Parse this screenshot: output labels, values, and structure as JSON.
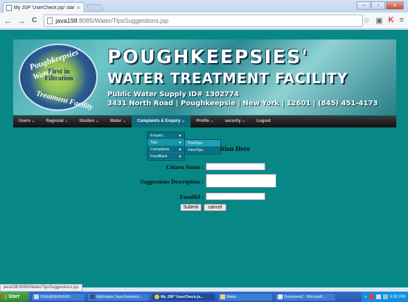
{
  "browser": {
    "tab_title": "My JSP 'UserCheck.jsp' starti",
    "tab_close": "×",
    "window_buttons": [
      "–",
      "▫",
      "x"
    ],
    "nav": {
      "back": "←",
      "forward": "→",
      "reload": "C"
    },
    "url_host": "java198",
    "url_path": ":8085/Water/TipsSuggestions.jsp",
    "status_text": "java198:8085/Water/TipsSuggestions.jsp"
  },
  "banner": {
    "logo_top": "Poughkeepsies' Water",
    "logo_center": "First in Filtration",
    "logo_bottom": "Treatment Facility",
    "title": "POUGHKEEPSIES'",
    "subtitle": "WATER TREATMENT FACILITY",
    "line1": "Public Water Supply ID# 1302774",
    "line2": "3431 North Road | Poughkeepsie | New York | 12601 | (845) 451-4173"
  },
  "menu": {
    "items": [
      "Users ⌄",
      "Regional ⌄",
      "Studies ⌄",
      "Water ⌄",
      "Complaints & Enquiry ⌄",
      "Profile ⌄",
      "security ⌄",
      "Logout"
    ]
  },
  "dropdown": {
    "items": [
      "Enquiry",
      "Tips",
      "Complaints",
      "FeedBack"
    ],
    "arrow": "►"
  },
  "submenu": {
    "items": [
      "PostTips",
      "ViewTips"
    ]
  },
  "form": {
    "heading": "ition Here",
    "citizen_label": "Citizen Name :",
    "suggestions_label": "Suggestions Description :",
    "email_label": "EmailId :",
    "submit_label": "Submit",
    "cancel_label": "cancel"
  },
  "taskbar": {
    "start": "Start",
    "tasks": [
      "ISSA@SERVER3",
      "MyEclipse Java Enterpris...",
      "My JSP 'UserCheck.js...",
      "Water",
      "Document1 - Microsoft ..."
    ],
    "tray_chevron": "«",
    "clock": "5:32 PM"
  },
  "colors": {
    "page_background": "#088787",
    "menu_active": "#0f6a7d",
    "taskbar": "#2356b0"
  }
}
